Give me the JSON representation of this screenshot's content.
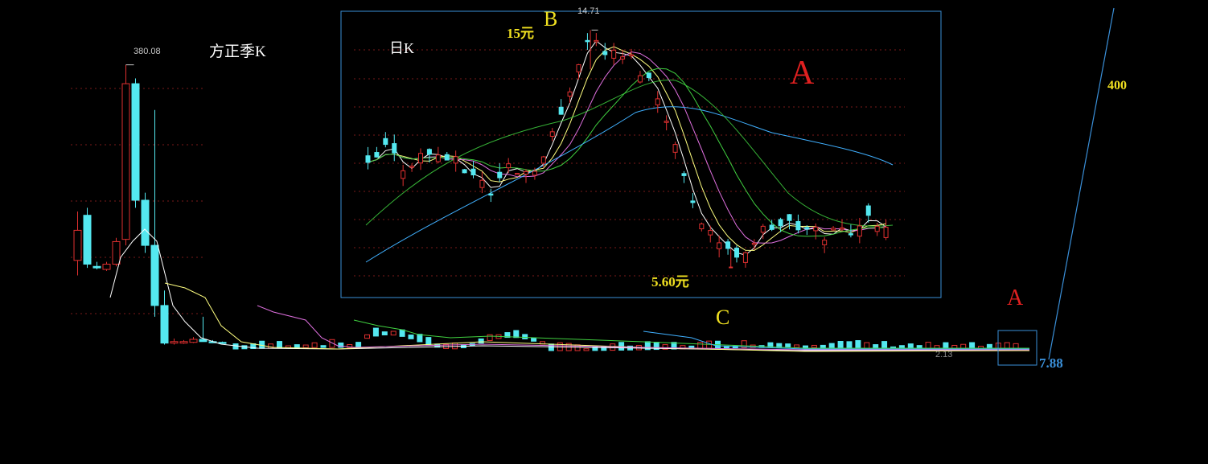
{
  "title_quarterly": "方正季K",
  "title_daily": "日K",
  "labels": {
    "peak_quarterly": "380.08",
    "peak_daily": "14.71",
    "point_B": "B",
    "point_B_price": "15元",
    "point_C": "C",
    "low_daily": "5.60元",
    "region_A_big": "A",
    "region_A_small": "A",
    "target": "400",
    "current_price": "7.88",
    "low_quarterly": "2.13"
  },
  "colors": {
    "up": "#e03030",
    "down": "#54e8f0",
    "ma5": "#ffffff",
    "ma10": "#ffff80",
    "ma20": "#e070e0",
    "ma30": "#40d040",
    "ma60": "#40b0ff",
    "annotation_yellow": "#f0e020",
    "annotation_red": "#e02020",
    "annotation_blue": "#3a8fd8",
    "grid": "#7a1a1a"
  },
  "chart_data": [
    {
      "type": "candlestick",
      "name": "方正季K",
      "scale": "linear",
      "ylim": [
        0,
        400
      ],
      "annotations": {
        "max": 380.08,
        "min": 2.13,
        "last": 7.88
      },
      "quarters": [
        {
          "o": 120,
          "h": 185,
          "l": 100,
          "c": 160
        },
        {
          "o": 180,
          "h": 190,
          "l": 110,
          "c": 115
        },
        {
          "o": 112,
          "h": 118,
          "l": 108,
          "c": 110
        },
        {
          "o": 108,
          "h": 118,
          "l": 106,
          "c": 115
        },
        {
          "o": 115,
          "h": 150,
          "l": 112,
          "c": 145
        },
        {
          "o": 148,
          "h": 380.08,
          "l": 140,
          "c": 355
        },
        {
          "o": 355,
          "h": 362,
          "l": 190,
          "c": 200
        },
        {
          "o": 200,
          "h": 210,
          "l": 130,
          "c": 140
        },
        {
          "o": 140,
          "h": 320,
          "l": 45,
          "c": 60
        },
        {
          "o": 60,
          "h": 80,
          "l": 8,
          "c": 10
        },
        {
          "o": 10,
          "h": 16,
          "l": 8,
          "c": 12
        },
        {
          "o": 10,
          "h": 14,
          "l": 9,
          "c": 12
        },
        {
          "o": 11,
          "h": 18,
          "l": 10,
          "c": 15
        },
        {
          "o": 15,
          "h": 45,
          "l": 12,
          "c": 12
        },
        {
          "o": 12,
          "h": 14,
          "l": 10,
          "c": 11
        },
        {
          "o": 11,
          "h": 12,
          "l": 9,
          "c": 10
        }
      ]
    },
    {
      "type": "candlestick",
      "name": "日K",
      "scale": "linear",
      "ylim": [
        5,
        15
      ],
      "annotations": {
        "max": 14.71,
        "min": 5.6
      },
      "series": [
        "MA5",
        "MA10",
        "MA20",
        "MA30",
        "MA60"
      ]
    }
  ]
}
